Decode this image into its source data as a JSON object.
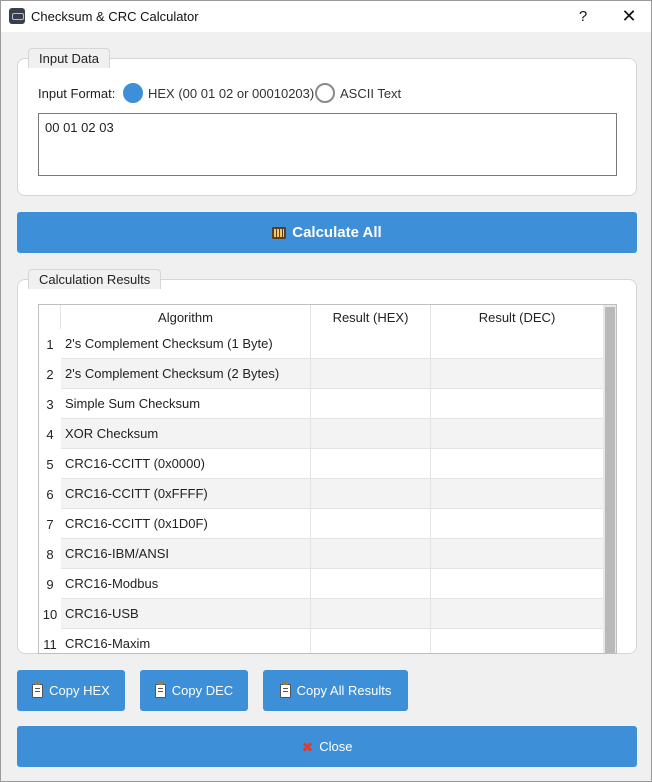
{
  "window": {
    "title": "Checksum & CRC Calculator",
    "help_label": "?",
    "close_label": "✕"
  },
  "input": {
    "group_title": "Input Data",
    "format_label": "Input Format:",
    "hex_option": "HEX (00 01 02 or 00010203)",
    "ascii_option": "ASCII Text",
    "selected": "hex",
    "value": "00 01 02 03"
  },
  "buttons": {
    "calculate": "Calculate All",
    "copy_hex": "Copy HEX",
    "copy_dec": "Copy DEC",
    "copy_all": "Copy All Results",
    "close": "Close"
  },
  "results": {
    "group_title": "Calculation Results",
    "columns": [
      "Algorithm",
      "Result (HEX)",
      "Result (DEC)"
    ],
    "rows": [
      {
        "n": "1",
        "algorithm": "2's Complement Checksum (1 Byte)",
        "hex": "",
        "dec": ""
      },
      {
        "n": "2",
        "algorithm": "2's Complement Checksum (2 Bytes)",
        "hex": "",
        "dec": ""
      },
      {
        "n": "3",
        "algorithm": "Simple Sum Checksum",
        "hex": "",
        "dec": ""
      },
      {
        "n": "4",
        "algorithm": "XOR Checksum",
        "hex": "",
        "dec": ""
      },
      {
        "n": "5",
        "algorithm": "CRC16-CCITT (0x0000)",
        "hex": "",
        "dec": ""
      },
      {
        "n": "6",
        "algorithm": "CRC16-CCITT (0xFFFF)",
        "hex": "",
        "dec": ""
      },
      {
        "n": "7",
        "algorithm": "CRC16-CCITT (0x1D0F)",
        "hex": "",
        "dec": ""
      },
      {
        "n": "8",
        "algorithm": "CRC16-IBM/ANSI",
        "hex": "",
        "dec": ""
      },
      {
        "n": "9",
        "algorithm": "CRC16-Modbus",
        "hex": "",
        "dec": ""
      },
      {
        "n": "10",
        "algorithm": "CRC16-USB",
        "hex": "",
        "dec": ""
      },
      {
        "n": "11",
        "algorithm": "CRC16-Maxim",
        "hex": "",
        "dec": ""
      }
    ]
  },
  "colors": {
    "accent": "#3d8fd8",
    "close_icon": "#e23b2e"
  }
}
